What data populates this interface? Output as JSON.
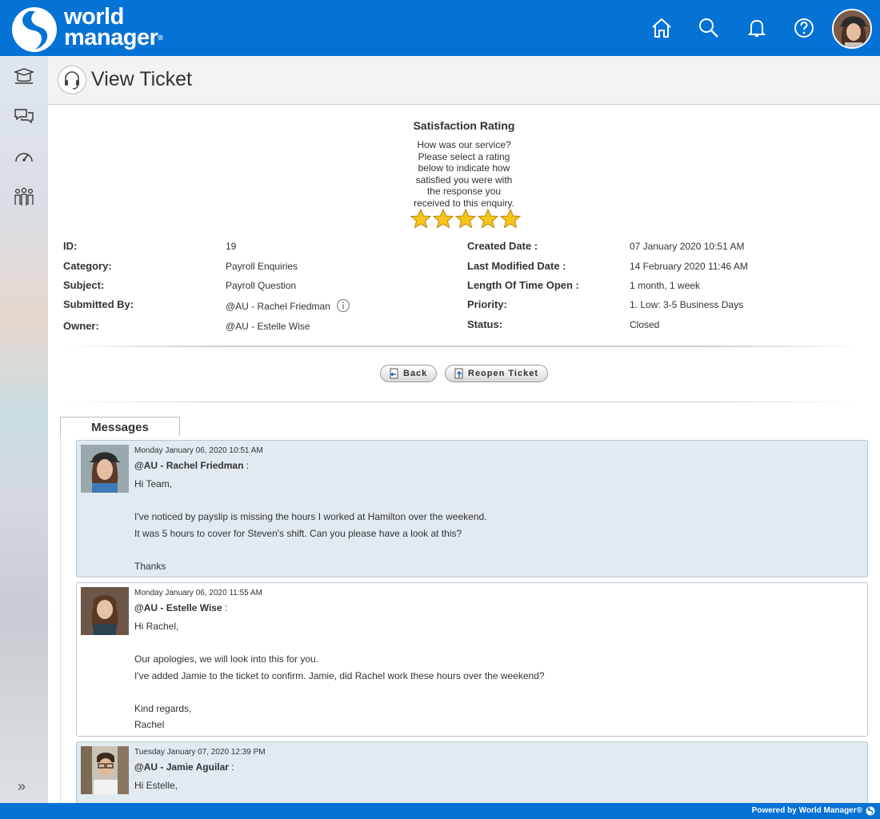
{
  "brand": {
    "line1": "world",
    "line2": "manager",
    "reg": "®"
  },
  "page": {
    "title": "View Ticket"
  },
  "satisfaction": {
    "title": "Satisfaction Rating",
    "text": "How was our service? Please select a rating below to indicate how satisfied you were with the response you received to this enquiry.",
    "rating": 5,
    "max": 5
  },
  "details": {
    "id_label": "ID:",
    "id_value": "19",
    "category_label": "Category:",
    "category_value": "Payroll Enquiries",
    "subject_label": "Subject:",
    "subject_value": "Payroll Question",
    "submitted_label": "Submitted By:",
    "submitted_value": "@AU - Rachel Friedman",
    "owner_label": "Owner:",
    "owner_value": "@AU - Estelle Wise",
    "created_label": "Created Date :",
    "created_value": "07 January 2020 10:51 AM",
    "modified_label": "Last Modified Date :",
    "modified_value": "14 February 2020 11:46 AM",
    "length_label": "Length Of Time Open :",
    "length_value": "1 month, 1 week",
    "priority_label": "Priority:",
    "priority_value": "1. Low: 3-5 Business Days",
    "status_label": "Status:",
    "status_value": "Closed"
  },
  "buttons": {
    "back": "Back",
    "reopen": "Reopen Ticket"
  },
  "messages_tab": "Messages",
  "messages": [
    {
      "date": "Monday January 06, 2020 10:51 AM",
      "author": "@AU - Rachel Friedman",
      "sep": " :",
      "body": "Hi Team,\n\nI've noticed by payslip is missing the hours I worked at Hamilton over the weekend.\nIt was 5 hours to cover for Steven's shift. Can you please have a look at this?\n\nThanks"
    },
    {
      "date": "Monday January 06, 2020 11:55 AM",
      "author": "@AU - Estelle Wise",
      "sep": " :",
      "body": "Hi Rachel,\n\nOur apologies, we will look into this for you.\nI've added Jamie to the ticket to confirm. Jamie, did Rachel work these hours over the weekend?\n\nKind regards,\nRachel"
    },
    {
      "date": "Tuesday January 07, 2020 12:39 PM",
      "author": "@AU - Jamie Aguilar",
      "sep": " :",
      "body": "Hi Estelle,"
    }
  ],
  "footer": "Powered by World Manager®",
  "colors": {
    "brand_blue": "#0572d6",
    "message_bg": "#e1eaf0",
    "star": "#f5c518"
  },
  "icons": {
    "top": [
      "home-icon",
      "search-icon",
      "bell-icon",
      "help-icon"
    ],
    "side": [
      "learning-icon",
      "chat-icon",
      "dashboard-icon",
      "people-icon"
    ]
  }
}
